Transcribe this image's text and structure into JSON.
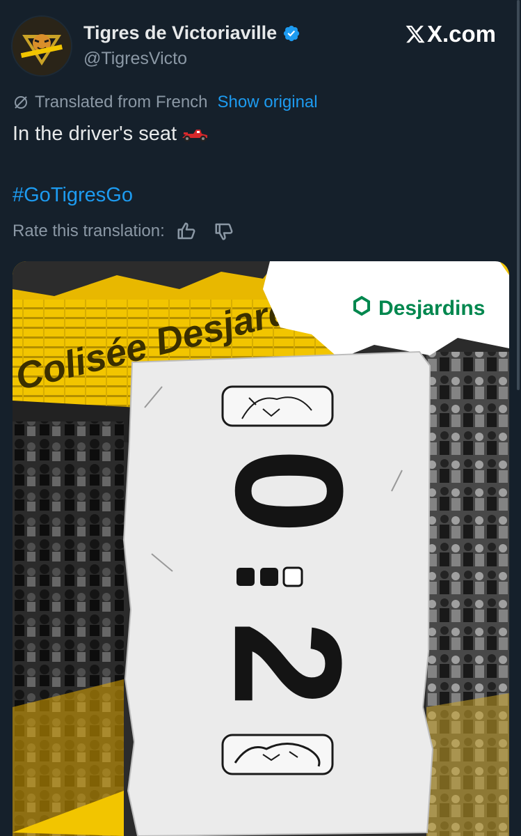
{
  "header": {
    "display_name": "Tigres de Victoriaville",
    "handle": "@TigresVicto",
    "site_brand": "X.com"
  },
  "translation": {
    "notice": "Translated from French",
    "show_original": "Show original",
    "rate_label": "Rate this translation:"
  },
  "tweet": {
    "text": "In the driver's seat",
    "hashtag": "#GoTigresGo"
  },
  "media": {
    "sponsor": "Desjardins",
    "arena_sign": "Colisée Desjardins",
    "score_top": "0",
    "score_bottom": "2",
    "series_dots": [
      "filled",
      "filled",
      "empty"
    ]
  },
  "colors": {
    "background": "#15202b",
    "link": "#1d9bf0",
    "muted_text": "#8b98a5",
    "brand_yellow": "#f2c500",
    "desjardins_green": "#00874e"
  }
}
